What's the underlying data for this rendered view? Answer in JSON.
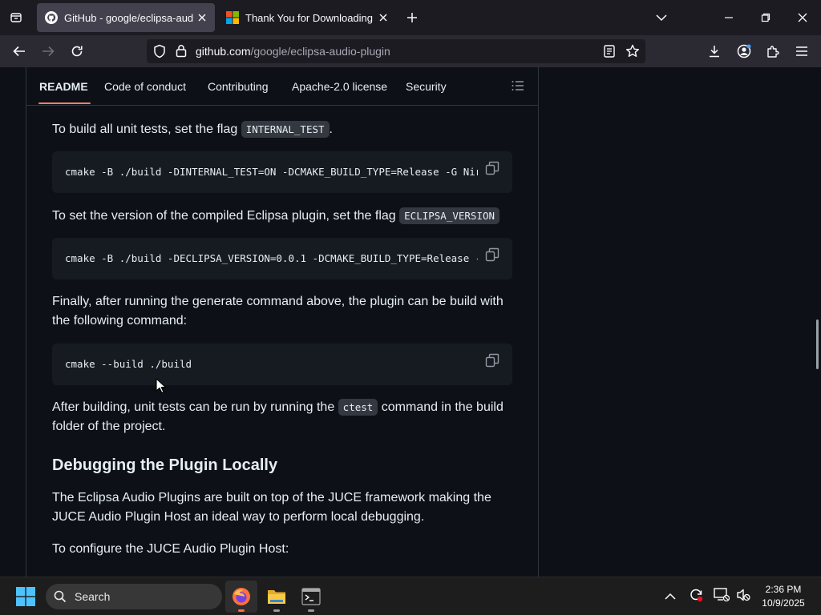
{
  "browser": {
    "tabs": [
      {
        "title": "GitHub - google/eclipsa-audio-",
        "active": true
      },
      {
        "title": "Thank You for Downloading Vis",
        "active": false
      }
    ],
    "url_domain": "github.com",
    "url_path": "/google/eclipsa-audio-plugin"
  },
  "readme_nav": {
    "tabs": [
      "README",
      "Code of conduct",
      "Contributing",
      "Apache-2.0 license",
      "Security"
    ],
    "active": "README"
  },
  "content": {
    "p1_text": "To build all unit tests, set the flag ",
    "p1_code": "INTERNAL_TEST",
    "p1_end": ".",
    "code1": "cmake -B ./build -DINTERNAL_TEST=ON -DCMAKE_BUILD_TYPE=Release -G Nir",
    "p2_text": "To set the version of the compiled Eclipsa plugin, set the flag ",
    "p2_code": "ECLIPSA_VERSION",
    "code2": "cmake -B ./build -DECLIPSA_VERSION=0.0.1 -DCMAKE_BUILD_TYPE=Release -",
    "p3": "Finally, after running the generate command above, the plugin can be build with the following command:",
    "code3": "cmake --build ./build",
    "p4_text_a": "After building, unit tests can be run by running the ",
    "p4_code": "ctest",
    "p4_text_b": " command in the build folder of the project.",
    "heading": "Debugging the Plugin Locally",
    "p5": "The Eclipsa Audio Plugins are built on top of the JUCE framework making the JUCE Audio Plugin Host an ideal way to perform local debugging.",
    "p6": "To configure the JUCE Audio Plugin Host:"
  },
  "taskbar": {
    "search_label": "Search",
    "time": "2:36 PM",
    "date": "10/9/2025"
  },
  "colors": {
    "page_bg": "#0d1117",
    "tab_underline": "#f78166",
    "code_bg": "#161b22"
  }
}
